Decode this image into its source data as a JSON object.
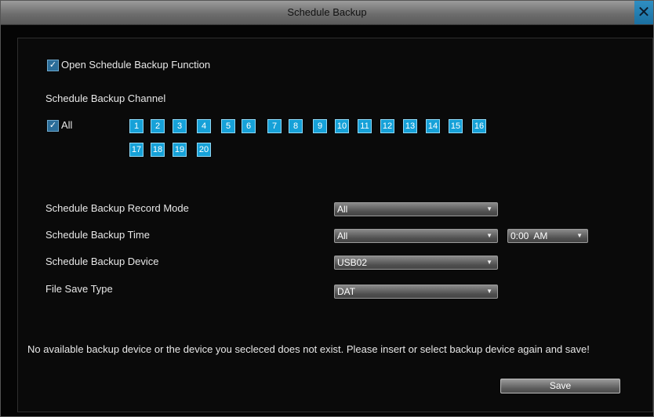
{
  "window": {
    "title": "Schedule Backup",
    "close_glyph": "✕",
    "close_icon": "close-icon"
  },
  "open_function": {
    "checked": true,
    "check_glyph": "✓",
    "label": "Open Schedule Backup Function"
  },
  "channel_section": {
    "title": "Schedule Backup Channel",
    "all": {
      "checked": true,
      "check_glyph": "✓",
      "label": "All"
    },
    "channels": [
      "1",
      "2",
      "3",
      "4",
      "5",
      "6",
      "7",
      "8",
      "9",
      "10",
      "11",
      "12",
      "13",
      "14",
      "15",
      "16",
      "17",
      "18",
      "19",
      "20"
    ]
  },
  "settings": {
    "record_mode": {
      "label": "Schedule Backup Record Mode",
      "value": "All"
    },
    "time": {
      "label": "Schedule Backup Time",
      "value": "All",
      "time_value": "0:00  AM"
    },
    "device": {
      "label": "Schedule Backup Device",
      "value": "USB02"
    },
    "file_type": {
      "label": "File Save Type",
      "value": "DAT"
    },
    "arrow_glyph": "▼"
  },
  "message": "No available backup device or the device you secleced does not exist. Please insert or select backup device again and save!",
  "save_label": "Save",
  "colors": {
    "channel_bg": "#16a1d8",
    "checkbox_bg": "#2b6d99",
    "close_bg": "#1b6fa0"
  }
}
